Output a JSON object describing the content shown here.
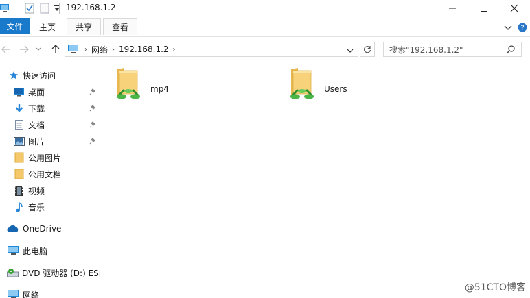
{
  "window": {
    "title": "192.168.1.2"
  },
  "ribbon": {
    "tabs": [
      {
        "label": "文件"
      },
      {
        "label": "主页"
      },
      {
        "label": "共享"
      },
      {
        "label": "查看"
      }
    ]
  },
  "address": {
    "crumbs": [
      "网络",
      "192.168.1.2"
    ],
    "search_placeholder": "搜索\"192.168.1.2\""
  },
  "nav": {
    "quick_access": "快速访问",
    "items": [
      {
        "label": "桌面",
        "icon": "desktop-icon",
        "pinned": true
      },
      {
        "label": "下载",
        "icon": "download-icon",
        "pinned": true
      },
      {
        "label": "文档",
        "icon": "document-icon",
        "pinned": true
      },
      {
        "label": "图片",
        "icon": "pictures-icon",
        "pinned": true
      },
      {
        "label": "公用图片",
        "icon": "folder-icon",
        "pinned": false
      },
      {
        "label": "公用文档",
        "icon": "folder-icon",
        "pinned": false
      },
      {
        "label": "视频",
        "icon": "video-icon",
        "pinned": false
      },
      {
        "label": "音乐",
        "icon": "music-icon",
        "pinned": false
      }
    ],
    "onedrive": "OneDrive",
    "this_pc": "此电脑",
    "dvd": "DVD 驱动器 (D:) ESD",
    "network": "网络"
  },
  "content": {
    "shares": [
      {
        "name": "mp4",
        "icon": "shared-folder-icon"
      },
      {
        "name": "Users",
        "icon": "shared-folder-icon"
      }
    ]
  },
  "watermark": "@51CTO博客",
  "colors": {
    "accent": "#1979ca",
    "folder": "#f5c96b",
    "network_green": "#3aa335"
  }
}
